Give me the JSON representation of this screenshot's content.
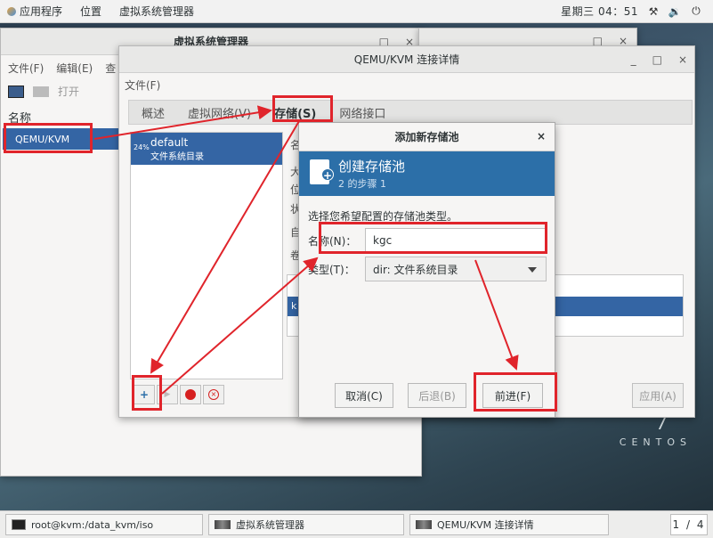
{
  "topbar": {
    "apps": "应用程序",
    "places": "位置",
    "active_app": "虚拟系统管理器",
    "clock": "星期三 04：51"
  },
  "back_window": {
    "title": "虚拟系统管理器",
    "menu": [
      "文件(F)",
      "编辑(E)",
      "查"
    ],
    "open_label": "打开",
    "name_header": "名称",
    "connection": "QEMU/KVM"
  },
  "qemu_window": {
    "title": "QEMU/KVM 连接详情",
    "menu_file": "文件(F)",
    "tabs": [
      "概述",
      "虚拟网络(V)",
      "存储(S)",
      "网络接口"
    ],
    "pool": {
      "percent": "24%",
      "name": "default",
      "desc": "文件系统目录"
    },
    "detail_labels": [
      "名",
      "大",
      "位",
      "状",
      "自",
      "卷"
    ],
    "vol_selected": "k",
    "apply_label": "应用(A)"
  },
  "dialog": {
    "title": "添加新存储池",
    "close": "×",
    "banner_title": "创建存储池",
    "banner_step": "2 的步骤 1",
    "prompt": "选择您希望配置的存储池类型。",
    "name_label": "名称(N)：",
    "name_value": "kgc",
    "type_label": "类型(T)：",
    "type_value": "dir: 文件系统目录",
    "cancel": "取消(C)",
    "back": "后退(B)",
    "forward": "前进(F)"
  },
  "taskbar": {
    "terminal": "root@kvm:/data_kvm/iso",
    "vmm": "虚拟系统管理器",
    "details": "QEMU/KVM 连接详情",
    "pager": "1 / 4"
  },
  "watermark": "CENTOS",
  "colors": {
    "selection": "#3465a4",
    "banner": "#2c6fa8",
    "annotation": "#e0242b"
  }
}
